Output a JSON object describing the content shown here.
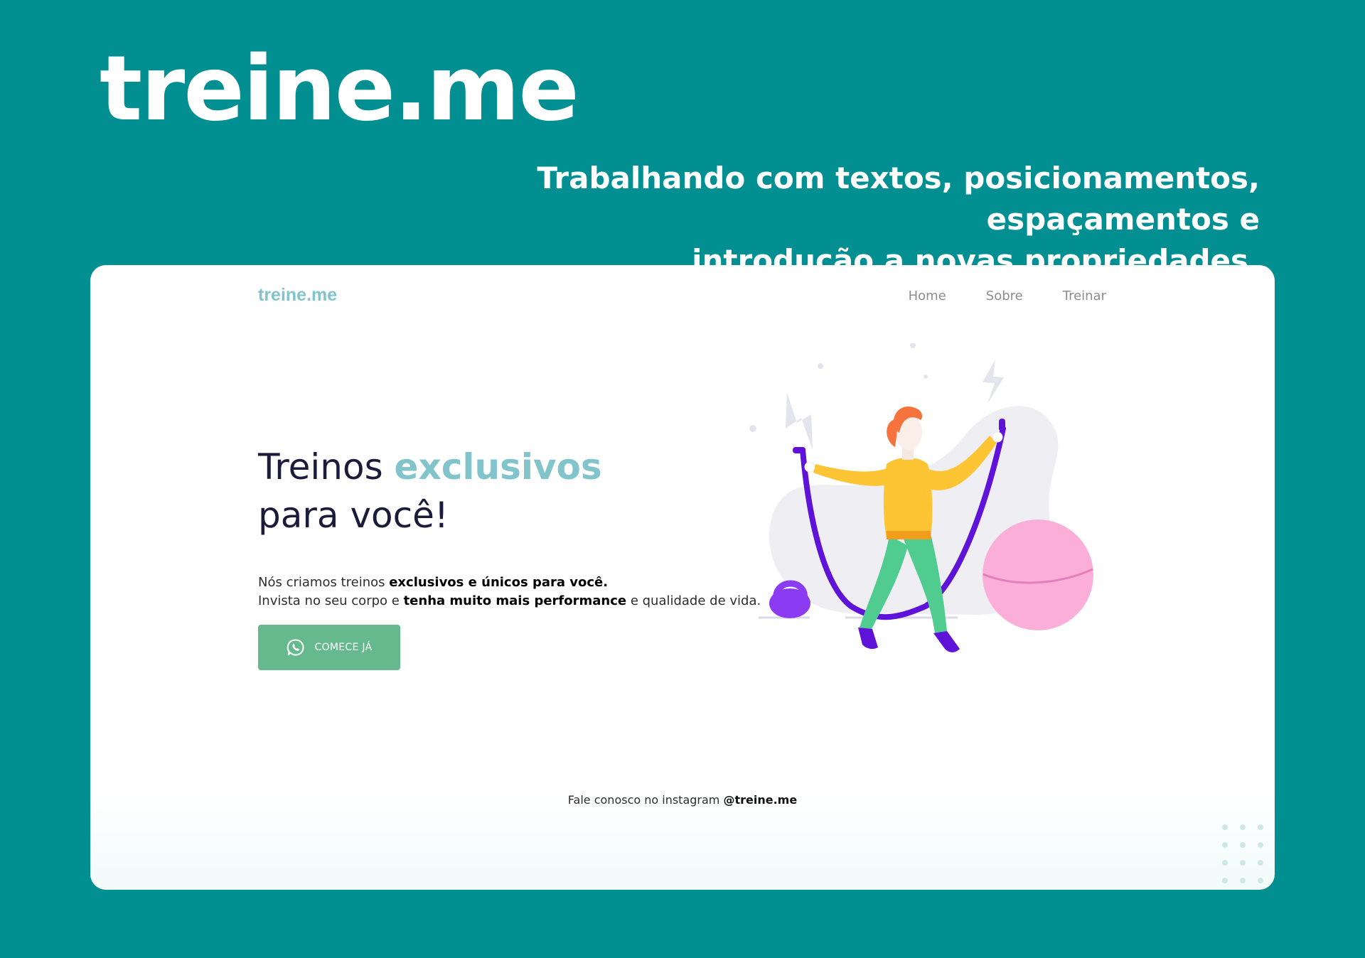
{
  "banner": {
    "title": "treine.me",
    "subtitle_line1": "Trabalhando com textos, posicionamentos, espaçamentos e",
    "subtitle_line2": "introdução a novas propriedades."
  },
  "site": {
    "brand": "treine.me",
    "nav": [
      "Home",
      "Sobre",
      "Treinar"
    ],
    "hero": {
      "headline_part1": "Treinos ",
      "headline_accent": "exclusivos",
      "headline_line2": "para você!",
      "line1_text": "Nós criamos treinos ",
      "line1_bold": "exclusivos e únicos para você.",
      "line2_text1": "Invista no seu corpo e ",
      "line2_bold": "tenha muito mais performance",
      "line2_text2": " e qualidade de vida.",
      "cta_label": "COMECE JÁ",
      "cta_icon": "whatsapp-icon"
    },
    "footer": {
      "text": "Fale conosco no instagram ",
      "handle": "@treine.me"
    }
  },
  "colors": {
    "background": "#028f92",
    "accent": "#82c4cb",
    "cta": "#66b98d",
    "headline": "#1d1b3a"
  }
}
